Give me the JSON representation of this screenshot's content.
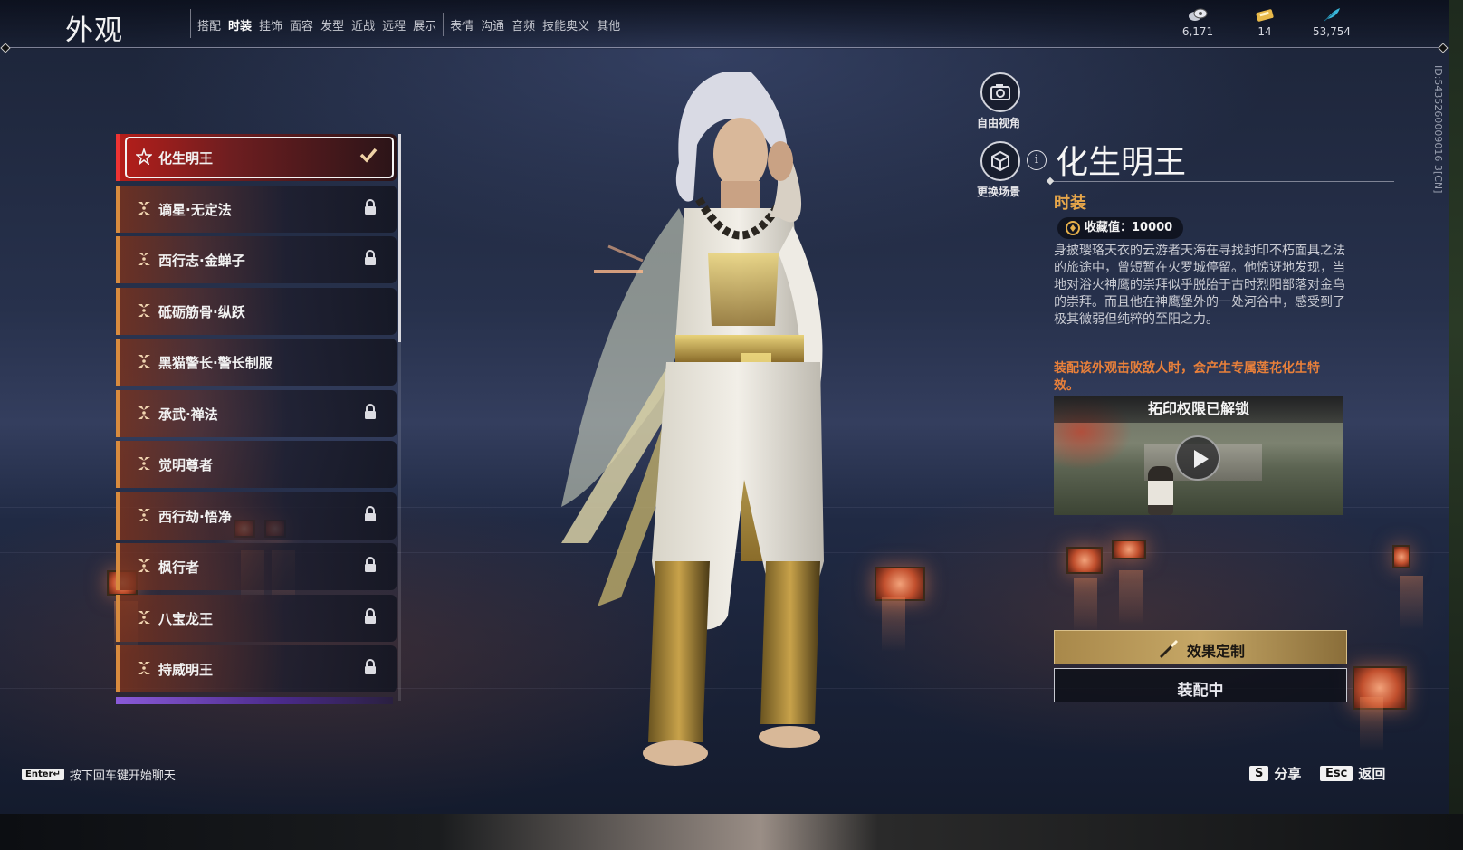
{
  "header": {
    "title": "外观",
    "tabs": [
      "搭配",
      "时装",
      "挂饰",
      "面容",
      "发型",
      "近战",
      "远程",
      "展示",
      "表情",
      "沟通",
      "音频",
      "技能奥义",
      "其他"
    ],
    "active_tab": "时装",
    "currencies": [
      {
        "icon": "coin-stack-icon",
        "value": "6,171"
      },
      {
        "icon": "ticket-icon",
        "value": "14"
      },
      {
        "icon": "feather-icon",
        "value": "53,754"
      }
    ]
  },
  "side_id": "ID:5435260009016 3[CN]",
  "list": {
    "items": [
      {
        "name": "化生明王",
        "selected": true,
        "locked": false,
        "equipped": true
      },
      {
        "name": "谪星·无定法",
        "selected": false,
        "locked": true,
        "equipped": false
      },
      {
        "name": "西行志·金蝉子",
        "selected": false,
        "locked": true,
        "equipped": false
      },
      {
        "name": "砥砺筋骨·纵跃",
        "selected": false,
        "locked": false,
        "equipped": false
      },
      {
        "name": "黑猫警长·警长制服",
        "selected": false,
        "locked": false,
        "equipped": false
      },
      {
        "name": "承武·禅法",
        "selected": false,
        "locked": true,
        "equipped": false
      },
      {
        "name": "觉明尊者",
        "selected": false,
        "locked": false,
        "equipped": false
      },
      {
        "name": "西行劫·悟净",
        "selected": false,
        "locked": true,
        "equipped": false
      },
      {
        "name": "枫行者",
        "selected": false,
        "locked": true,
        "equipped": false
      },
      {
        "name": "八宝龙王",
        "selected": false,
        "locked": true,
        "equipped": false
      },
      {
        "name": "持威明王",
        "selected": false,
        "locked": true,
        "equipped": false
      }
    ]
  },
  "view_controls": {
    "free_camera": "自由视角",
    "change_scene": "更换场景"
  },
  "detail": {
    "title": "化生明王",
    "type": "时装",
    "collect_value": "收藏值：10000",
    "description": "身披璎珞天衣的云游者天海在寻找封印不朽面具之法的旅途中，曾短暂在火罗城停留。他惊讶地发现，当地对浴火神鹰的崇拜似乎脱胎于古时烈阳部落对金乌的崇拜。而且他在神鹰堡外的一处河谷中，感受到了极其微弱但纯粹的至阳之力。",
    "effect_note": "装配该外观击败敌人时，会产生专属莲花化生特效。",
    "video_banner": "拓印权限已解锁",
    "custom_button": "效果定制",
    "equip_button": "装配中"
  },
  "footer": {
    "chat_key": "Enter↵",
    "chat_hint": "按下回车键开始聊天",
    "share_key": "S",
    "share_label": "分享",
    "back_key": "Esc",
    "back_label": "返回"
  },
  "colors": {
    "accent_red": "#e33",
    "accent_orange": "#e9803a",
    "gold": "#c6a766",
    "list_border": "#d88b3e"
  }
}
